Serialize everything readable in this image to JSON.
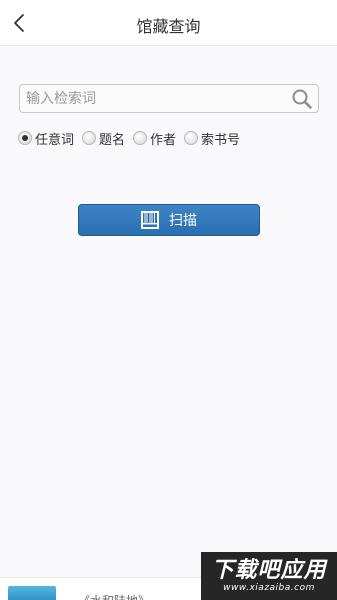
{
  "header": {
    "title": "馆藏查询",
    "back_icon": "chevron-left-icon"
  },
  "search": {
    "placeholder": "输入检索词",
    "value": "",
    "icon": "search-icon"
  },
  "search_fields": [
    {
      "label": "任意词",
      "selected": true
    },
    {
      "label": "题名",
      "selected": false
    },
    {
      "label": "作者",
      "selected": false
    },
    {
      "label": "索书号",
      "selected": false
    }
  ],
  "scan_button": {
    "label": "扫描",
    "icon": "barcode-icon"
  },
  "bottom_item": {
    "title": "《水和陆地》"
  },
  "watermark": {
    "main": "下载吧应用",
    "url": "www.xiazaiba.com"
  },
  "colors": {
    "accent": "#2a6fb0",
    "text": "#333333",
    "placeholder": "#9a9a9a",
    "background": "#f9f9fb"
  }
}
